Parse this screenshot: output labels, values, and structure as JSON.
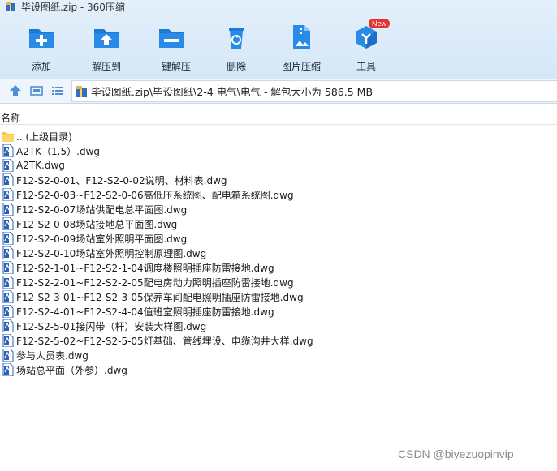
{
  "window": {
    "title": "毕设图纸.zip - 360压缩"
  },
  "toolbar": {
    "add_label": "添加",
    "extract_to_label": "解压到",
    "one_click_extract_label": "一键解压",
    "delete_label": "删除",
    "image_compress_label": "图片压缩",
    "tools_label": "工具",
    "new_badge": "New"
  },
  "path": {
    "text": "毕设图纸.zip\\毕设图纸\\2-4 电气\\电气 - 解包大小为 586.5 MB"
  },
  "list": {
    "header": "名称",
    "parent": ".. (上级目录)",
    "files": [
      "A2TK（1.5）.dwg",
      "A2TK.dwg",
      "F12-S2-0-01、F12-S2-0-02说明、材料表.dwg",
      "F12-S2-0-03~F12-S2-0-06高低压系统图、配电箱系统图.dwg",
      "F12-S2-0-07场站供配电总平面图.dwg",
      "F12-S2-0-08场站接地总平面图.dwg",
      "F12-S2-0-09场站室外照明平面图.dwg",
      "F12-S2-0-10场站室外照明控制原理图.dwg",
      "F12-S2-1-01~F12-S2-1-04调度楼照明插座防雷接地.dwg",
      "F12-S2-2-01~F12-S2-2-05配电房动力照明插座防雷接地.dwg",
      "F12-S2-3-01~F12-S2-3-05保养车间配电照明插座防雷接地.dwg",
      "F12-S2-4-01~F12-S2-4-04值班室照明插座防雷接地.dwg",
      "F12-S2-5-01接闪带（杆）安装大样图.dwg",
      "F12-S2-5-02~F12-S2-5-05灯基础、管线埋设、电缆沟井大样.dwg",
      "参与人员表.dwg",
      "场站总平面（外参）.dwg"
    ]
  },
  "watermark": "CSDN @biyezuopinvip"
}
